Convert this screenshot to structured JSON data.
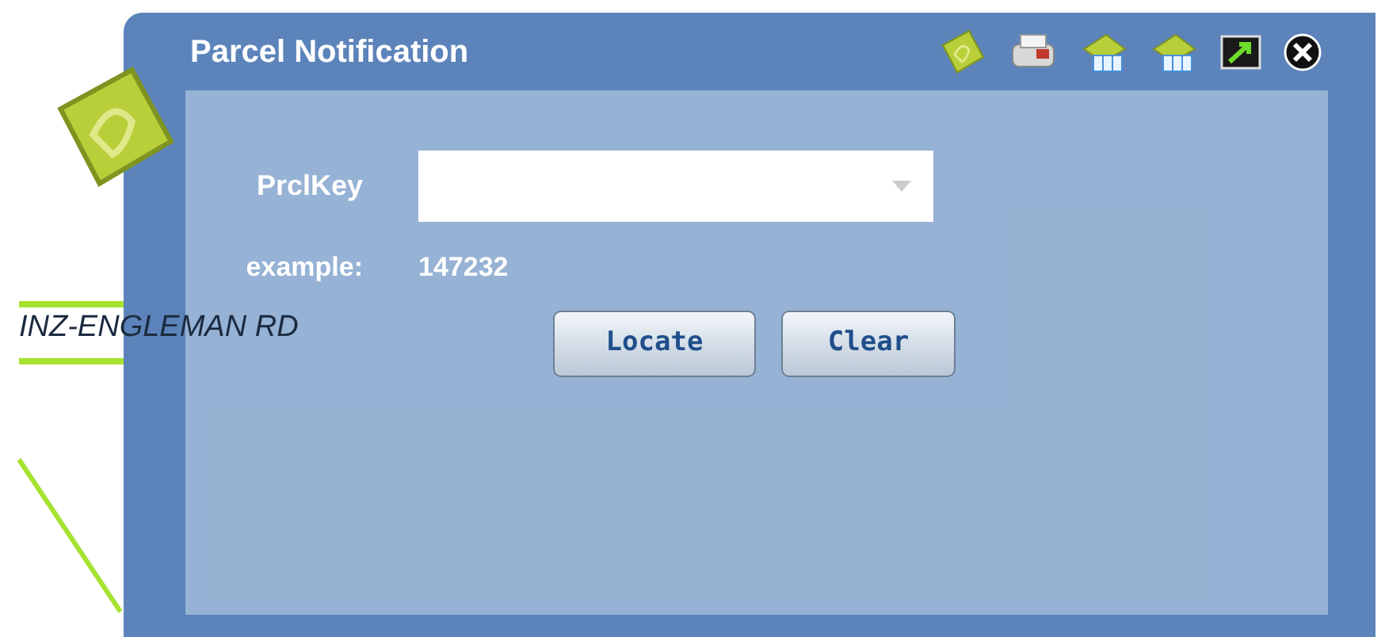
{
  "map": {
    "road_label": "INZ-ENGLEMAN RD"
  },
  "window": {
    "title": "Parcel Notification"
  },
  "toolbar": [
    {
      "kind": "parcel"
    },
    {
      "kind": "printer"
    },
    {
      "kind": "table"
    },
    {
      "kind": "table"
    },
    {
      "kind": "export"
    },
    {
      "kind": "close"
    }
  ],
  "form": {
    "label": "PrclKey",
    "example_label": "example:",
    "example_value": "147232"
  },
  "buttons": [
    "Locate",
    "Clear"
  ]
}
